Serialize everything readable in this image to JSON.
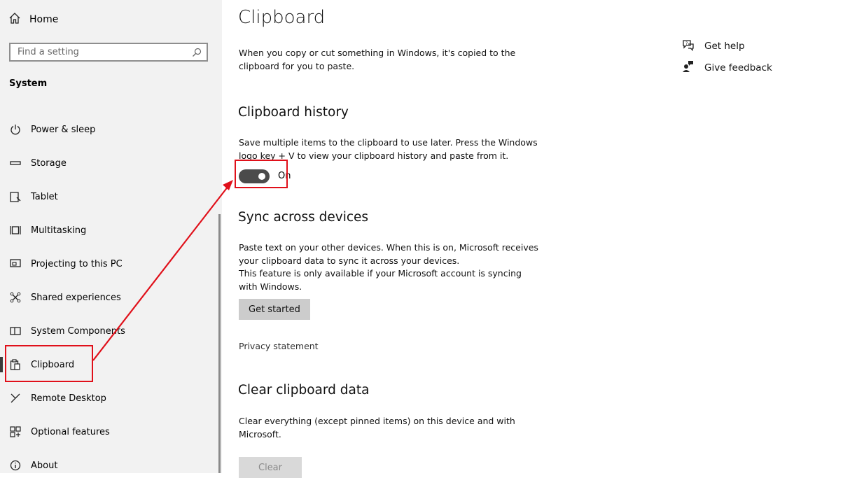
{
  "sidebar": {
    "home_label": "Home",
    "search_placeholder": "Find a setting",
    "section_title": "System",
    "items": [
      {
        "label": "Power & sleep",
        "icon": "power-icon"
      },
      {
        "label": "Storage",
        "icon": "storage-icon"
      },
      {
        "label": "Tablet",
        "icon": "tablet-icon"
      },
      {
        "label": "Multitasking",
        "icon": "multitasking-icon"
      },
      {
        "label": "Projecting to this PC",
        "icon": "projecting-icon"
      },
      {
        "label": "Shared experiences",
        "icon": "shared-experiences-icon"
      },
      {
        "label": "System Components",
        "icon": "system-components-icon"
      },
      {
        "label": "Clipboard",
        "icon": "clipboard-icon",
        "selected": true
      },
      {
        "label": "Remote Desktop",
        "icon": "remote-desktop-icon"
      },
      {
        "label": "Optional features",
        "icon": "optional-features-icon"
      },
      {
        "label": "About",
        "icon": "about-icon"
      }
    ]
  },
  "main": {
    "title": "Clipboard",
    "intro": "When you copy or cut something in Windows, it's copied to the clipboard for you to paste.",
    "history": {
      "heading": "Clipboard history",
      "description": "Save multiple items to the clipboard to use later. Press the Windows logo key + V to view your clipboard history and paste from it.",
      "toggle_state": "On"
    },
    "sync": {
      "heading": "Sync across devices",
      "description": "Paste text on your other devices. When this is on, Microsoft receives your clipboard data to sync it across your devices.",
      "note": "This feature is only available if your Microsoft account is syncing with Windows.",
      "button_label": "Get started",
      "privacy_link": "Privacy statement"
    },
    "clear": {
      "heading": "Clear clipboard data",
      "description": "Clear everything (except pinned items) on this device and with Microsoft.",
      "button_label": "Clear"
    }
  },
  "help": {
    "get_help": "Get help",
    "give_feedback": "Give feedback"
  },
  "colors": {
    "annotation": "#e0101a",
    "toggle_on": "#4b4b4b",
    "sidebar_bg": "#f2f2f2"
  }
}
